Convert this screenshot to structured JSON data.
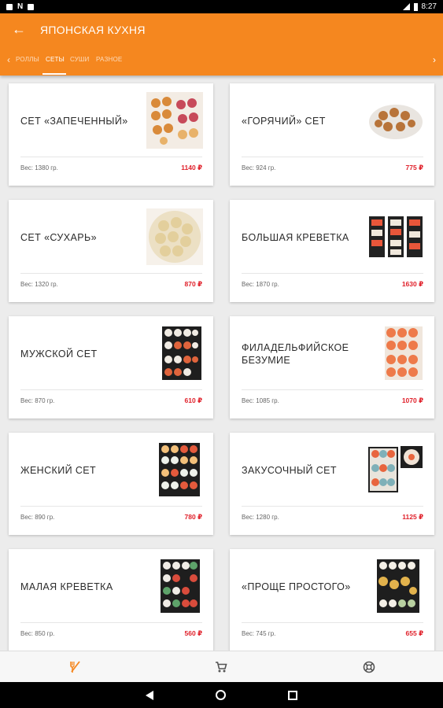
{
  "status_bar": {
    "time": "8:27"
  },
  "app_bar": {
    "title": "ЯПОНСКАЯ КУХНЯ"
  },
  "tabs": [
    {
      "label": "РОЛЛЫ",
      "active": false
    },
    {
      "label": "СЕТЫ",
      "active": true
    },
    {
      "label": "СУШИ",
      "active": false
    },
    {
      "label": "РАЗНОЕ",
      "active": false
    }
  ],
  "products": [
    {
      "name": "СЕТ «ЗАПЕЧЕННЫЙ»",
      "weight": "Вес: 1380 гр.",
      "price": "1140 ₽",
      "image": "set-baked-photo"
    },
    {
      "name": "«ГОРЯЧИЙ» СЕТ",
      "weight": "Вес: 924 гр.",
      "price": "775 ₽",
      "image": "set-hot-photo"
    },
    {
      "name": "СЕТ «СУХАРЬ»",
      "weight": "Вес: 1320 гр.",
      "price": "870 ₽",
      "image": "set-sukhar-photo"
    },
    {
      "name": "БОЛЬШАЯ КРЕВЕТКА",
      "weight": "Вес: 1870 гр.",
      "price": "1630 ₽",
      "image": "set-big-shrimp-photo"
    },
    {
      "name": "МУЖСКОЙ СЕТ",
      "weight": "Вес: 870 гр.",
      "price": "610 ₽",
      "image": "set-mens-photo"
    },
    {
      "name": "ФИЛАДЕЛЬФИЙСКОЕ БЕЗУМИЕ",
      "weight": "Вес: 1085 гр.",
      "price": "1070 ₽",
      "image": "set-philadelphia-photo"
    },
    {
      "name": "ЖЕНСКИЙ СЕТ",
      "weight": "Вес: 890 гр.",
      "price": "780 ₽",
      "image": "set-womens-photo"
    },
    {
      "name": "ЗАКУСОЧНЫЙ СЕТ",
      "weight": "Вес: 1280 гр.",
      "price": "1125 ₽",
      "image": "set-snack-photo"
    },
    {
      "name": "МАЛАЯ КРЕВЕТКА",
      "weight": "Вес: 850 гр.",
      "price": "560 ₽",
      "image": "set-small-shrimp-photo"
    },
    {
      "name": "«ПРОЩЕ ПРОСТОГО»",
      "weight": "Вес: 745 гр.",
      "price": "655 ₽",
      "image": "set-simple-photo"
    }
  ],
  "bottom_nav": [
    {
      "icon": "utensils-icon",
      "active": true
    },
    {
      "icon": "cart-icon",
      "active": false
    },
    {
      "icon": "lifebuoy-icon",
      "active": false
    }
  ],
  "colors": {
    "accent": "#f5871f",
    "price": "#e0202a"
  }
}
